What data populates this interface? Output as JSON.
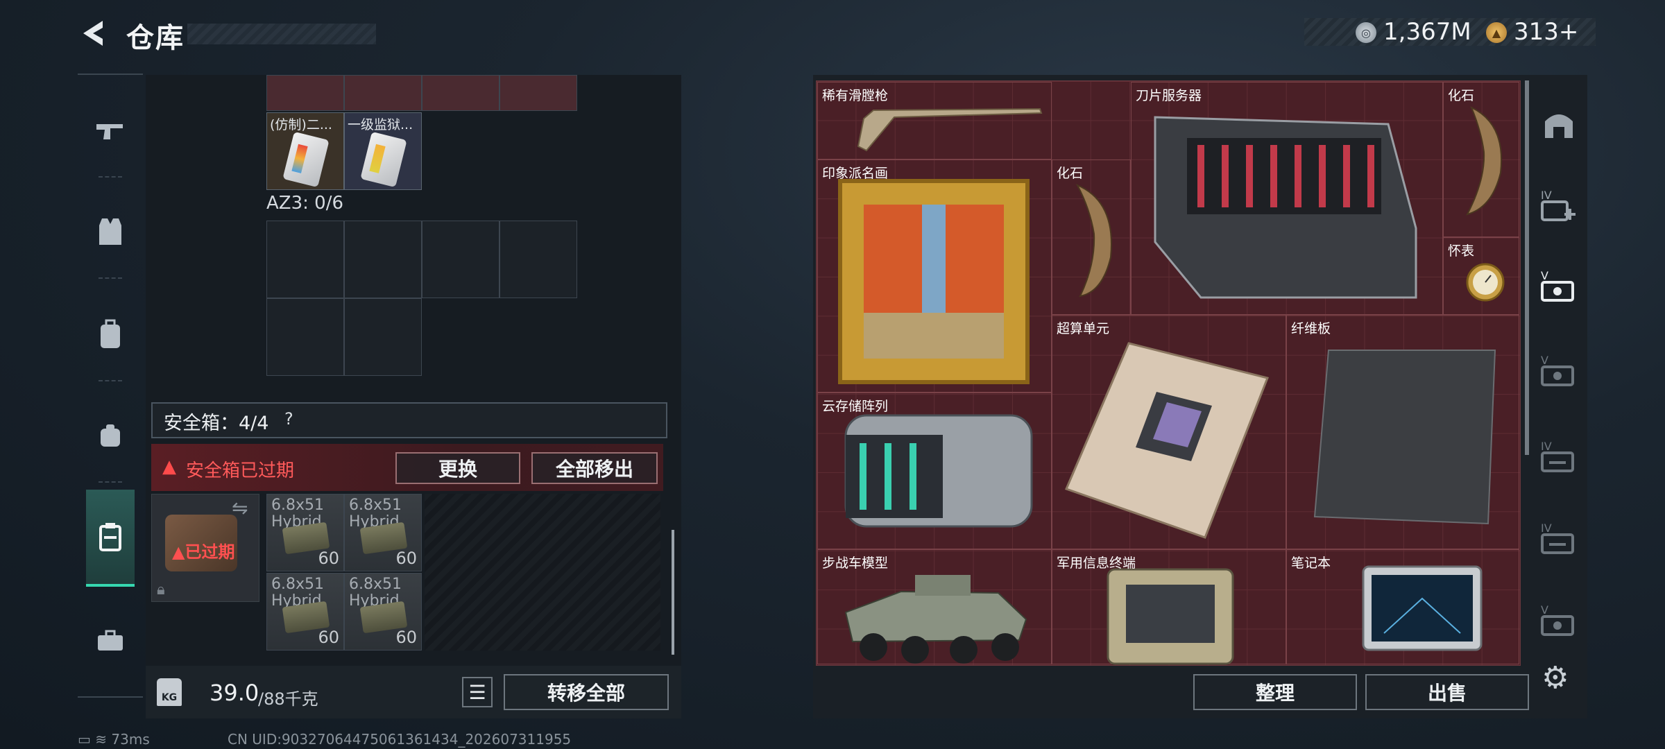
{
  "header": {
    "title": "仓库",
    "currency": [
      {
        "icon": "silver-coin-icon",
        "value": "1,367M"
      },
      {
        "icon": "gold-coin-icon",
        "value": "313+"
      }
    ]
  },
  "left_nav": [
    {
      "name": "weapons",
      "icon": "gun-icon"
    },
    {
      "name": "armor",
      "icon": "vest-icon"
    },
    {
      "name": "backpack",
      "icon": "backpack-icon"
    },
    {
      "name": "helmet",
      "icon": "pouch-icon"
    },
    {
      "name": "containers",
      "icon": "case-icon",
      "active": true
    },
    {
      "name": "tools",
      "icon": "toolbox-icon"
    }
  ],
  "top_items": [
    {
      "name": "(仿制)二..."
    },
    {
      "name": "一级监狱..."
    }
  ],
  "az3": {
    "label": "AZ3: 0/6"
  },
  "safe_box": {
    "label": "安全箱：4/4",
    "help": "?",
    "expired_banner": "安全箱已过期",
    "replace": "更换",
    "move_all": "全部移出",
    "case_status": "已过期"
  },
  "ammo": [
    {
      "name": "6.8x51",
      "sub": "Hybrid",
      "count": "60"
    },
    {
      "name": "6.8x51",
      "sub": "Hybrid",
      "count": "60"
    },
    {
      "name": "6.8x51",
      "sub": "Hybrid",
      "count": "60"
    },
    {
      "name": "6.8x51",
      "sub": "Hybrid",
      "count": "60"
    }
  ],
  "weight": {
    "current": "39.0",
    "max": "/88千克",
    "icon_label": "KG"
  },
  "buttons": {
    "transfer_all": "转移全部",
    "sort": "整理",
    "sell": "出售"
  },
  "stash_items": [
    {
      "name": "稀有滑膛枪"
    },
    {
      "name": "刀片服务器"
    },
    {
      "name": "化石"
    },
    {
      "name": "印象派名画"
    },
    {
      "name": "化石"
    },
    {
      "name": "怀表"
    },
    {
      "name": "超算单元"
    },
    {
      "name": "纤维板"
    },
    {
      "name": "云存储阵列"
    },
    {
      "name": "步战车模型"
    },
    {
      "name": "军用信息终端"
    },
    {
      "name": "笔记本"
    }
  ],
  "right_nav": [
    {
      "icon": "home-icon",
      "label": ""
    },
    {
      "icon": "tier-4-add-icon",
      "label": "IV"
    },
    {
      "icon": "tier-5-case-icon",
      "label": "V",
      "active": true
    },
    {
      "icon": "tier-5-case-icon",
      "label": "V"
    },
    {
      "icon": "tier-4-case-icon",
      "label": "IV"
    },
    {
      "icon": "tier-4-case-icon",
      "label": "IV"
    },
    {
      "icon": "tier-5-case-icon",
      "label": "V"
    }
  ],
  "status": {
    "ping": "73ms",
    "uid": "CN UID:90327064475061361434_202607311955"
  },
  "colors": {
    "accent": "#36d8b0",
    "alert": "#ff4b4b",
    "stash_bg": "#4a1f26"
  }
}
